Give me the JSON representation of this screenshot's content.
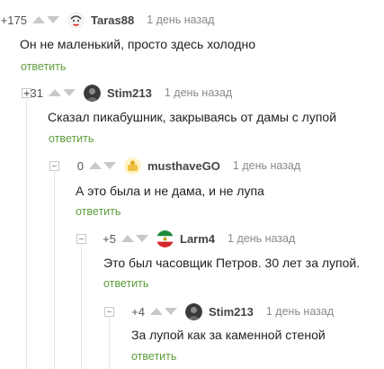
{
  "comments": [
    {
      "rating": "+175",
      "username": "Taras88",
      "time": "1 день назад",
      "text": "Он не маленький, просто здесь холодно",
      "reply": "ответить",
      "avatar": "face-sketch-avatar"
    },
    {
      "rating": "+31",
      "username": "Stim213",
      "time": "1 день назад",
      "text": "Сказал пикабушник, закрываясь от дамы с лупой",
      "reply": "ответить",
      "avatar": "dark-photo-avatar"
    },
    {
      "rating": "0",
      "username": "musthaveGO",
      "time": "1 день назад",
      "text": "А это была и не дама, и не лупа",
      "reply": "ответить",
      "avatar": "yellow-avatar"
    },
    {
      "rating": "+5",
      "username": "Larm4",
      "time": "1 день назад",
      "text": "Это был часовщик Петров. 30 лет за лупой.",
      "reply": "ответить",
      "avatar": "flag-avatar"
    },
    {
      "rating": "+4",
      "username": "Stim213",
      "time": "1 день назад",
      "text": "За лупой как за каменной стеной",
      "reply": "ответить",
      "avatar": "dark-photo-avatar"
    }
  ],
  "colors": {
    "reply_link": "#5e9d3c",
    "arrows": "#c8c8c8",
    "thread_line": "#e6e6e6",
    "username": "#444444",
    "timestamp": "#8a8a8a"
  }
}
